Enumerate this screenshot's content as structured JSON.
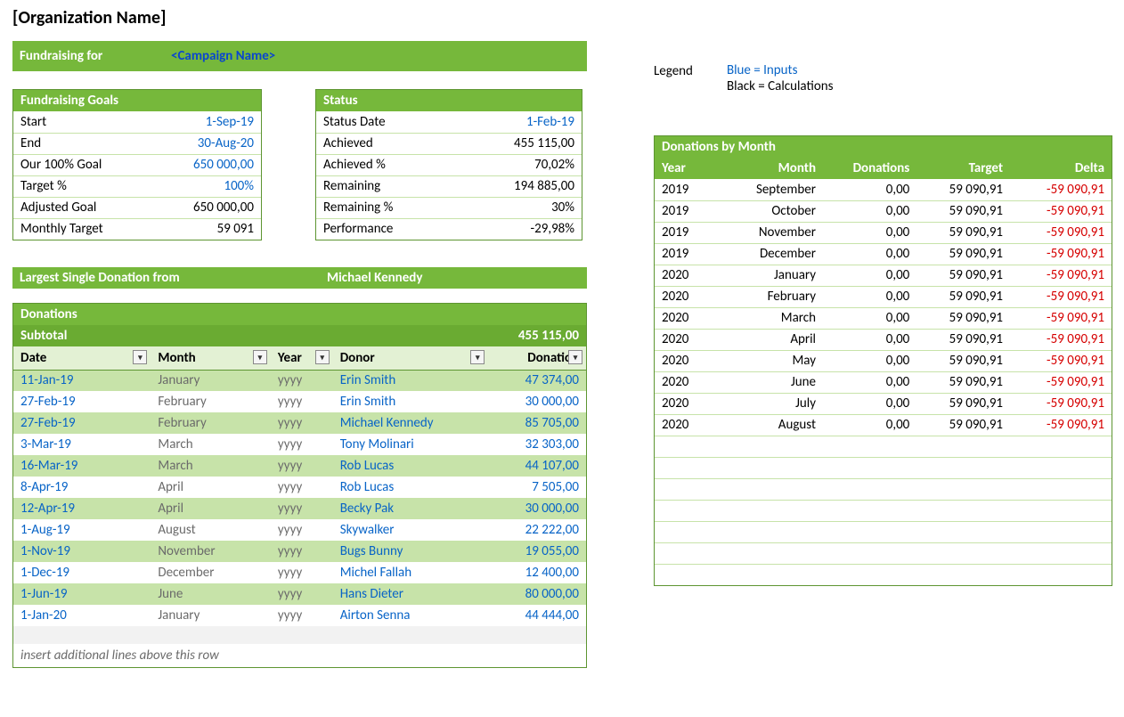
{
  "org_name": "[Organization Name]",
  "campaign_banner": {
    "label": "Fundraising for",
    "value": "<Campaign Name>"
  },
  "legend": {
    "title": "Legend",
    "inputs": "Blue = Inputs",
    "calc": "Black = Calculations"
  },
  "goals": {
    "title": "Fundraising Goals",
    "rows": [
      {
        "k": "Start",
        "v": "1-Sep-19",
        "input": true
      },
      {
        "k": "End",
        "v": "30-Aug-20",
        "input": true
      },
      {
        "k": "Our 100% Goal",
        "v": "650 000,00",
        "input": true
      },
      {
        "k": "Target %",
        "v": "100%",
        "input": true
      },
      {
        "k": "Adjusted Goal",
        "v": "650 000,00",
        "input": false
      },
      {
        "k": "Monthly Target",
        "v": "59 091",
        "input": false
      }
    ]
  },
  "status": {
    "title": "Status",
    "rows": [
      {
        "k": "Status Date",
        "v": "1-Feb-19",
        "input": true
      },
      {
        "k": "Achieved",
        "v": "455 115,00",
        "input": false
      },
      {
        "k": "Achieved %",
        "v": "70,02%",
        "input": false
      },
      {
        "k": "Remaining",
        "v": "194 885,00",
        "input": false
      },
      {
        "k": "Remaining %",
        "v": "30%",
        "input": false
      },
      {
        "k": "Performance",
        "v": "-29,98%",
        "input": false
      }
    ]
  },
  "largest": {
    "label": "Largest Single Donation from",
    "name": "Michael Kennedy"
  },
  "donations": {
    "title": "Donations",
    "subtotal_label": "Subtotal",
    "subtotal": "455 115,00",
    "cols": {
      "date": "Date",
      "month": "Month",
      "year": "Year",
      "donor": "Donor",
      "amount": "Donation"
    },
    "rows": [
      {
        "date": "11-Jan-19",
        "month": "January",
        "year": "yyyy",
        "donor": "Erin Smith",
        "amount": "47 374,00"
      },
      {
        "date": "27-Feb-19",
        "month": "February",
        "year": "yyyy",
        "donor": "Erin Smith",
        "amount": "30 000,00"
      },
      {
        "date": "27-Feb-19",
        "month": "February",
        "year": "yyyy",
        "donor": "Michael Kennedy",
        "amount": "85 705,00"
      },
      {
        "date": "3-Mar-19",
        "month": "March",
        "year": "yyyy",
        "donor": "Tony Molinari",
        "amount": "32 303,00"
      },
      {
        "date": "16-Mar-19",
        "month": "March",
        "year": "yyyy",
        "donor": "Rob Lucas",
        "amount": "44 107,00"
      },
      {
        "date": "8-Apr-19",
        "month": "April",
        "year": "yyyy",
        "donor": "Rob Lucas",
        "amount": "7 505,00"
      },
      {
        "date": "12-Apr-19",
        "month": "April",
        "year": "yyyy",
        "donor": "Becky Pak",
        "amount": "30 000,00"
      },
      {
        "date": "1-Aug-19",
        "month": "August",
        "year": "yyyy",
        "donor": "Skywalker",
        "amount": "22 222,00"
      },
      {
        "date": "1-Nov-19",
        "month": "November",
        "year": "yyyy",
        "donor": "Bugs Bunny",
        "amount": "19 055,00"
      },
      {
        "date": "1-Dec-19",
        "month": "December",
        "year": "yyyy",
        "donor": "Michel Fallah",
        "amount": "12 400,00"
      },
      {
        "date": "1-Jun-19",
        "month": "June",
        "year": "yyyy",
        "donor": "Hans Dieter",
        "amount": "80 000,00"
      },
      {
        "date": "1-Jan-20",
        "month": "January",
        "year": "yyyy",
        "donor": "Airton Senna",
        "amount": "44 444,00"
      }
    ],
    "footnote": "insert additional lines above this row"
  },
  "by_month": {
    "title": "Donations by Month",
    "cols": {
      "year": "Year",
      "month": "Month",
      "donations": "Donations",
      "target": "Target",
      "delta": "Delta"
    },
    "rows": [
      {
        "year": "2019",
        "month": "September",
        "donations": "0,00",
        "target": "59 090,91",
        "delta": "-59 090,91"
      },
      {
        "year": "2019",
        "month": "October",
        "donations": "0,00",
        "target": "59 090,91",
        "delta": "-59 090,91"
      },
      {
        "year": "2019",
        "month": "November",
        "donations": "0,00",
        "target": "59 090,91",
        "delta": "-59 090,91"
      },
      {
        "year": "2019",
        "month": "December",
        "donations": "0,00",
        "target": "59 090,91",
        "delta": "-59 090,91"
      },
      {
        "year": "2020",
        "month": "January",
        "donations": "0,00",
        "target": "59 090,91",
        "delta": "-59 090,91"
      },
      {
        "year": "2020",
        "month": "February",
        "donations": "0,00",
        "target": "59 090,91",
        "delta": "-59 090,91"
      },
      {
        "year": "2020",
        "month": "March",
        "donations": "0,00",
        "target": "59 090,91",
        "delta": "-59 090,91"
      },
      {
        "year": "2020",
        "month": "April",
        "donations": "0,00",
        "target": "59 090,91",
        "delta": "-59 090,91"
      },
      {
        "year": "2020",
        "month": "May",
        "donations": "0,00",
        "target": "59 090,91",
        "delta": "-59 090,91"
      },
      {
        "year": "2020",
        "month": "June",
        "donations": "0,00",
        "target": "59 090,91",
        "delta": "-59 090,91"
      },
      {
        "year": "2020",
        "month": "July",
        "donations": "0,00",
        "target": "59 090,91",
        "delta": "-59 090,91"
      },
      {
        "year": "2020",
        "month": "August",
        "donations": "0,00",
        "target": "59 090,91",
        "delta": "-59 090,91"
      }
    ],
    "blank_rows": 7
  }
}
